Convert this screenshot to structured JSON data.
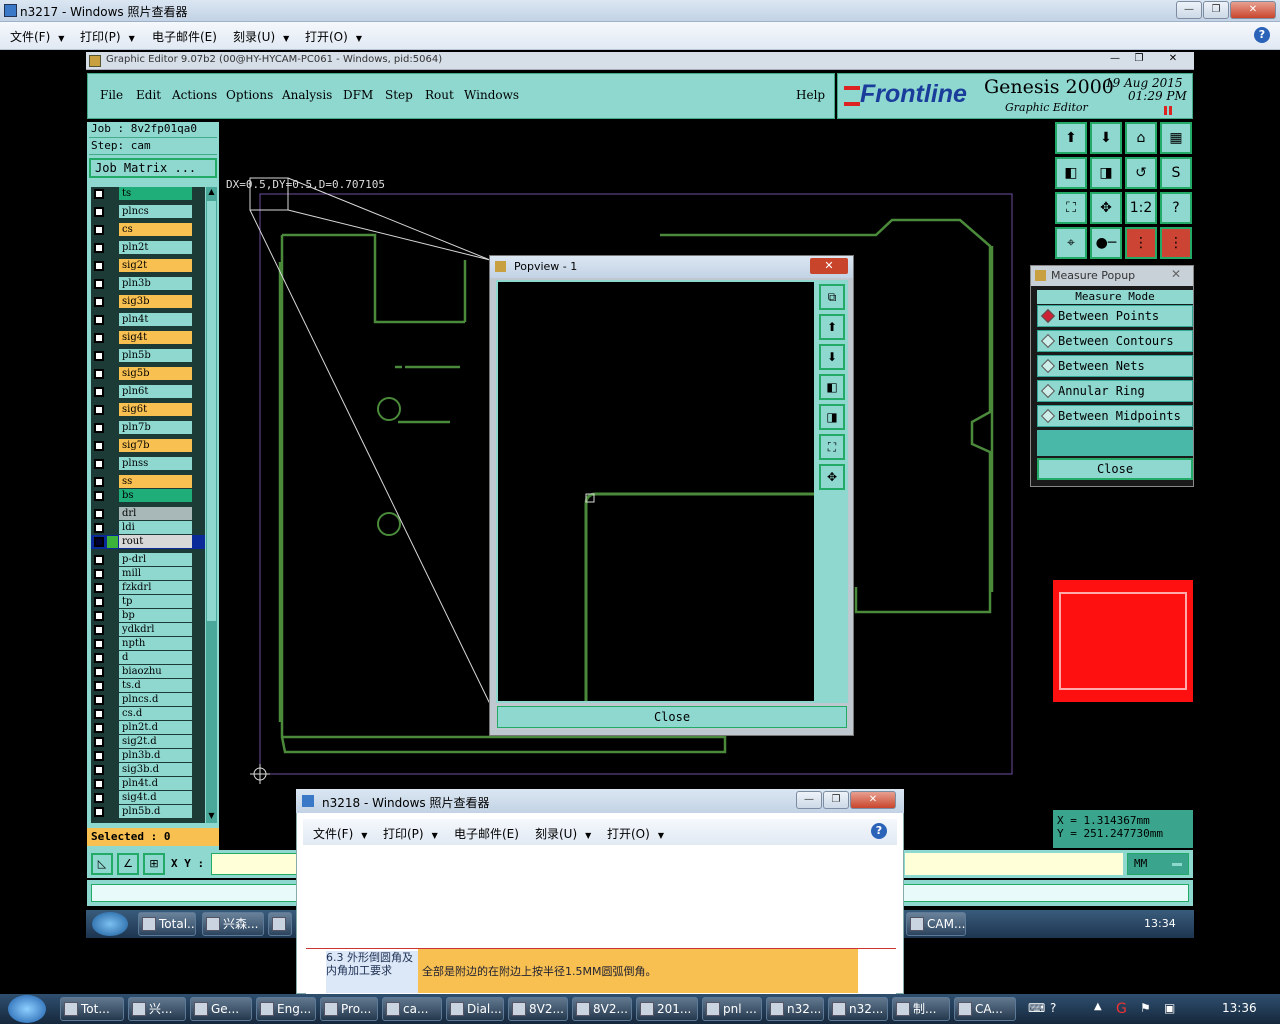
{
  "outer_window": {
    "title": "n3217 - Windows 照片查看器",
    "menu": [
      "文件(F)",
      "打印(P)",
      "电子邮件(E)",
      "刻录(U)",
      "打开(O)"
    ]
  },
  "genesis": {
    "title": "Graphic Editor 9.07b2 (00@HY-HYCAM-PC061 - Windows, pid:5064)",
    "menu": [
      "File",
      "Edit",
      "Actions",
      "Options",
      "Analysis",
      "DFM",
      "Step",
      "Rout",
      "Windows"
    ],
    "help": "Help",
    "logo": {
      "brand": "Frontline",
      "product": "Genesis 2000",
      "subtitle": "Graphic Editor",
      "date": "19 Aug 2015",
      "time": "01:29 PM"
    },
    "job": "Job  : 8v2fp01qa0",
    "step": "Step: cam",
    "job_matrix": "Job Matrix ...",
    "layers": [
      {
        "name": "ts",
        "color": "#1fae7a"
      },
      {
        "name": "plncs",
        "color": "#8ed8d0"
      },
      {
        "name": "cs",
        "color": "#f8c050"
      },
      {
        "name": "pln2t",
        "color": "#8ed8d0"
      },
      {
        "name": "sig2t",
        "color": "#f8c050"
      },
      {
        "name": "pln3b",
        "color": "#8ed8d0"
      },
      {
        "name": "sig3b",
        "color": "#f8c050"
      },
      {
        "name": "pln4t",
        "color": "#8ed8d0"
      },
      {
        "name": "sig4t",
        "color": "#f8c050"
      },
      {
        "name": "pln5b",
        "color": "#8ed8d0"
      },
      {
        "name": "sig5b",
        "color": "#f8c050"
      },
      {
        "name": "pln6t",
        "color": "#8ed8d0"
      },
      {
        "name": "sig6t",
        "color": "#f8c050"
      },
      {
        "name": "pln7b",
        "color": "#8ed8d0"
      },
      {
        "name": "sig7b",
        "color": "#f8c050"
      },
      {
        "name": "plnss",
        "color": "#8ed8d0"
      },
      {
        "name": "ss",
        "color": "#f8c050"
      },
      {
        "name": "bs",
        "color": "#1fae7a"
      },
      {
        "name": "drl",
        "color": "#a8b8b8"
      },
      {
        "name": "ldi",
        "color": "#8ed8d0"
      },
      {
        "name": "rout",
        "color": "#d8d8d8"
      },
      {
        "name": "p-drl",
        "color": "#8ed8d0"
      },
      {
        "name": "mill",
        "color": "#8ed8d0"
      },
      {
        "name": "fzkdrl",
        "color": "#8ed8d0"
      },
      {
        "name": "tp",
        "color": "#8ed8d0"
      },
      {
        "name": "bp",
        "color": "#8ed8d0"
      },
      {
        "name": "ydkdrl",
        "color": "#8ed8d0"
      },
      {
        "name": "npth",
        "color": "#8ed8d0"
      },
      {
        "name": "d",
        "color": "#8ed8d0"
      },
      {
        "name": "biaozhu",
        "color": "#8ed8d0"
      },
      {
        "name": "ts.d",
        "color": "#8ed8d0"
      },
      {
        "name": "plncs.d",
        "color": "#8ed8d0"
      },
      {
        "name": "cs.d",
        "color": "#8ed8d0"
      },
      {
        "name": "pln2t.d",
        "color": "#8ed8d0"
      },
      {
        "name": "sig2t.d",
        "color": "#8ed8d0"
      },
      {
        "name": "pln3b.d",
        "color": "#8ed8d0"
      },
      {
        "name": "sig3b.d",
        "color": "#8ed8d0"
      },
      {
        "name": "pln4t.d",
        "color": "#8ed8d0"
      },
      {
        "name": "sig4t.d",
        "color": "#8ed8d0"
      },
      {
        "name": "pln5b.d",
        "color": "#8ed8d0"
      }
    ],
    "selected": "Selected : 0",
    "measure_readout": "DX=0.5,DY=0.5,D=0.707105",
    "xy_label": "X Y :",
    "units": "MM",
    "coords": {
      "x": "X  = 1.314367mm",
      "y": "Y  = 251.247730mm"
    },
    "popview": {
      "title": "Popview - 1",
      "close": "Close"
    },
    "measure_popup": {
      "title": "Measure Popup",
      "header": "Measure Mode",
      "options": [
        "Between Points",
        "Between Contours",
        "Between Nets",
        "Annular Ring",
        "Between Midpoints"
      ],
      "selected": "Between Points",
      "close": "Close"
    },
    "inner_taskbar": {
      "items": [
        "Total...",
        "兴森...",
        "CAM..."
      ],
      "time": "13:34"
    }
  },
  "viewer2": {
    "title": "n3218 - Windows 照片查看器",
    "menu": [
      "文件(F)",
      "打印(P)",
      "电子邮件(E)",
      "刻录(U)",
      "打开(O)"
    ],
    "table": {
      "label": "6.3 外形倒圆角及内角加工要求",
      "value": "全部是附边的在附边上按半径1.5MM圆弧倒角。"
    }
  },
  "taskbar": {
    "items": [
      "Tot...",
      "兴...",
      "Ge...",
      "Eng...",
      "Pro...",
      "ca...",
      "Dial...",
      "8V2...",
      "8V2...",
      "201...",
      "pnl ...",
      "n32...",
      "n32...",
      "制...",
      "CA..."
    ],
    "time": "13:36"
  }
}
